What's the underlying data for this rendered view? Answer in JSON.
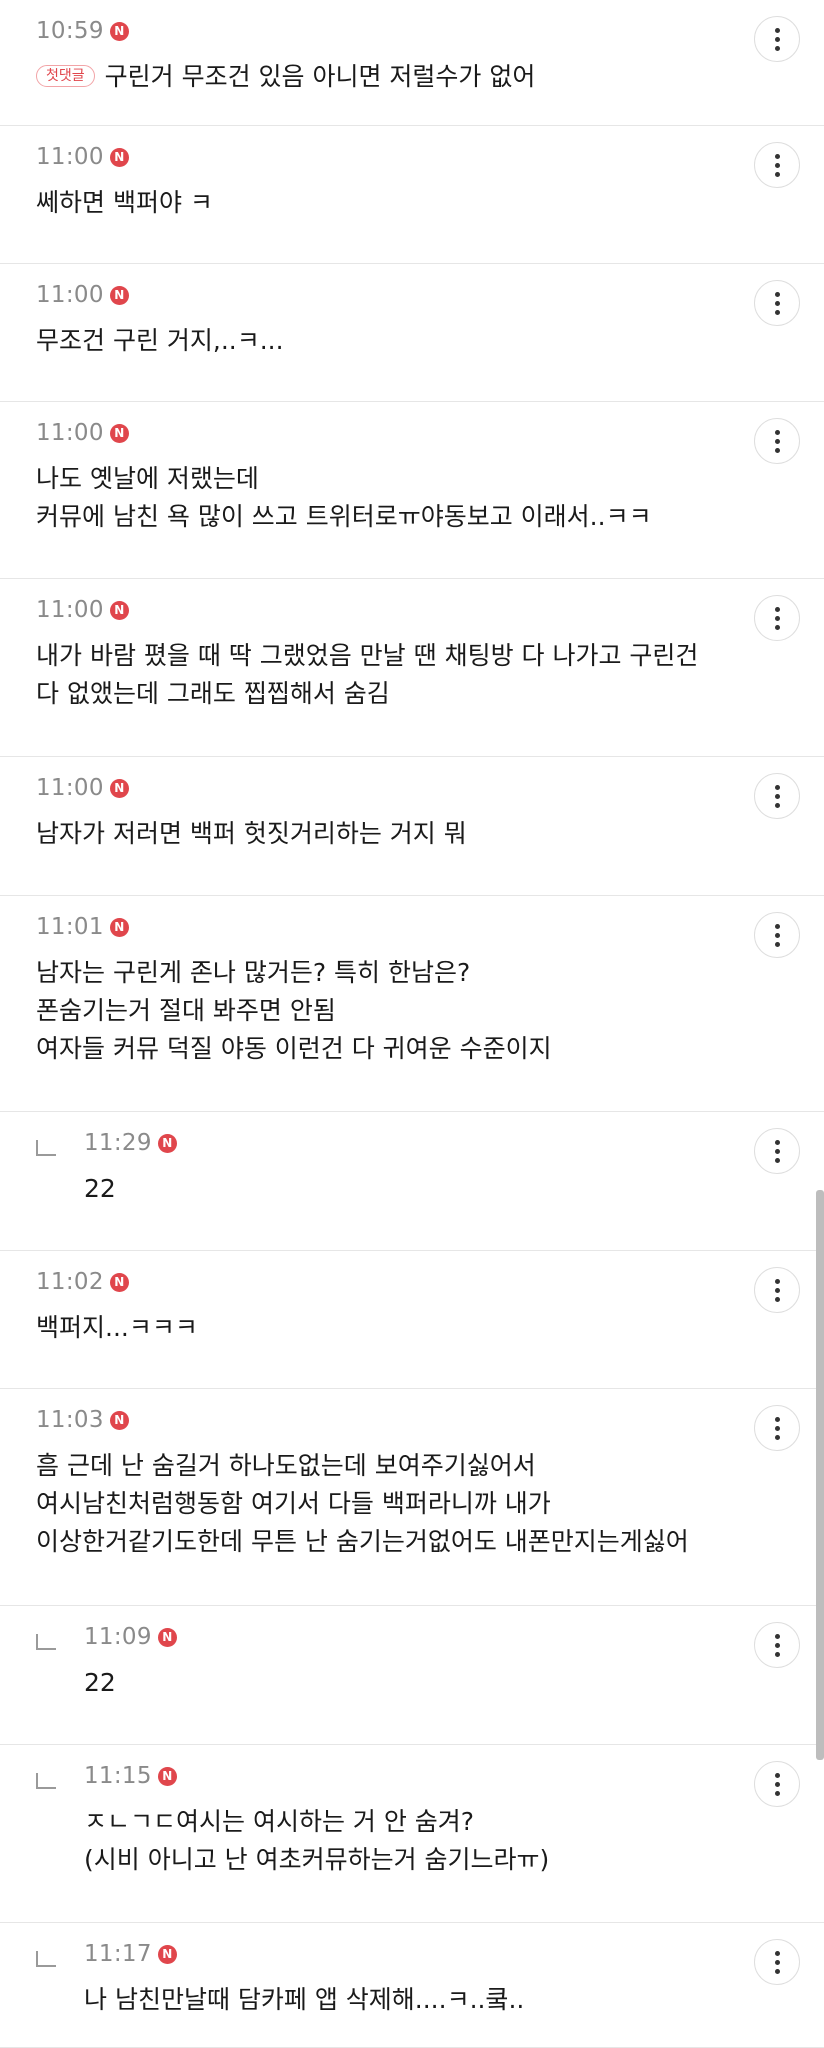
{
  "comments": [
    {
      "time": "10:59",
      "is_new": true,
      "first_comment_label": "첫댓글",
      "lines": [
        "구린거 무조건 있음 아니면 저럴수가 없어"
      ],
      "is_reply": false,
      "height": 126
    },
    {
      "time": "11:00",
      "is_new": true,
      "lines": [
        "쎄하면 백퍼야 ㅋ"
      ],
      "is_reply": false,
      "height": 138
    },
    {
      "time": "11:00",
      "is_new": true,
      "lines": [
        "무조건 구린 거지,..ㅋ..."
      ],
      "is_reply": false,
      "height": 138
    },
    {
      "time": "11:00",
      "is_new": true,
      "lines": [
        "나도 옛날에 저랬는데",
        "커뮤에 남친 욕 많이 쓰고 트위터로ㅠ야동보고 이래서..ㅋㅋ"
      ],
      "is_reply": false,
      "height": 177
    },
    {
      "time": "11:00",
      "is_new": true,
      "lines": [
        "내가 바람 폈을 때 딱 그랬었음 만날 땐 채팅방 다 나가고 구린건",
        "다 없앴는데 그래도 찝찝해서 숨김"
      ],
      "is_reply": false,
      "height": 178
    },
    {
      "time": "11:00",
      "is_new": true,
      "lines": [
        "남자가 저러면 백퍼 헛짓거리하는 거지 뭐"
      ],
      "is_reply": false,
      "height": 139
    },
    {
      "time": "11:01",
      "is_new": true,
      "lines": [
        "남자는 구린게 존나 많거든? 특히 한남은?",
        "폰숨기는거 절대 봐주면 안됨",
        "여자들 커뮤 덕질 야동 이런건 다 귀여운 수준이지"
      ],
      "is_reply": false,
      "height": 216
    },
    {
      "time": "11:29",
      "is_new": true,
      "lines": [
        "22"
      ],
      "is_reply": true,
      "height": 139
    },
    {
      "time": "11:02",
      "is_new": true,
      "lines": [
        "백퍼지...ㅋㅋㅋ"
      ],
      "is_reply": false,
      "height": 138
    },
    {
      "time": "11:03",
      "is_new": true,
      "lines": [
        "흠 근데 난 숨길거 하나도없는데 보여주기싫어서",
        "여시남친처럼행동함 여기서 다들 백퍼라니까 내가",
        "이상한거같기도한데 무튼 난 숨기는거없어도 내폰만지는게싫어"
      ],
      "is_reply": false,
      "height": 217
    },
    {
      "time": "11:09",
      "is_new": true,
      "lines": [
        "22"
      ],
      "is_reply": true,
      "height": 139
    },
    {
      "time": "11:15",
      "is_new": true,
      "lines": [
        "ㅈㄴㄱㄷ여시는 여시하는 거 안 숨겨?",
        "(시비 아니고 난 여초커뮤하는거 숨기느라ㅠ)"
      ],
      "is_reply": true,
      "height": 178
    },
    {
      "time": "11:17",
      "is_new": true,
      "lines": [
        "나 남친만날때 담카페 앱 삭제해....ㅋ..쿸.."
      ],
      "is_reply": true,
      "height": 125
    }
  ],
  "new_badge_text": "N",
  "icons": {
    "more": "more-vertical-icon",
    "new": "new-badge-icon",
    "reply": "reply-arrow-icon"
  },
  "colors": {
    "accent": "#e0464c",
    "time": "#8a8a8a",
    "text": "#1a1a1a",
    "divider": "#e6e6e6"
  }
}
